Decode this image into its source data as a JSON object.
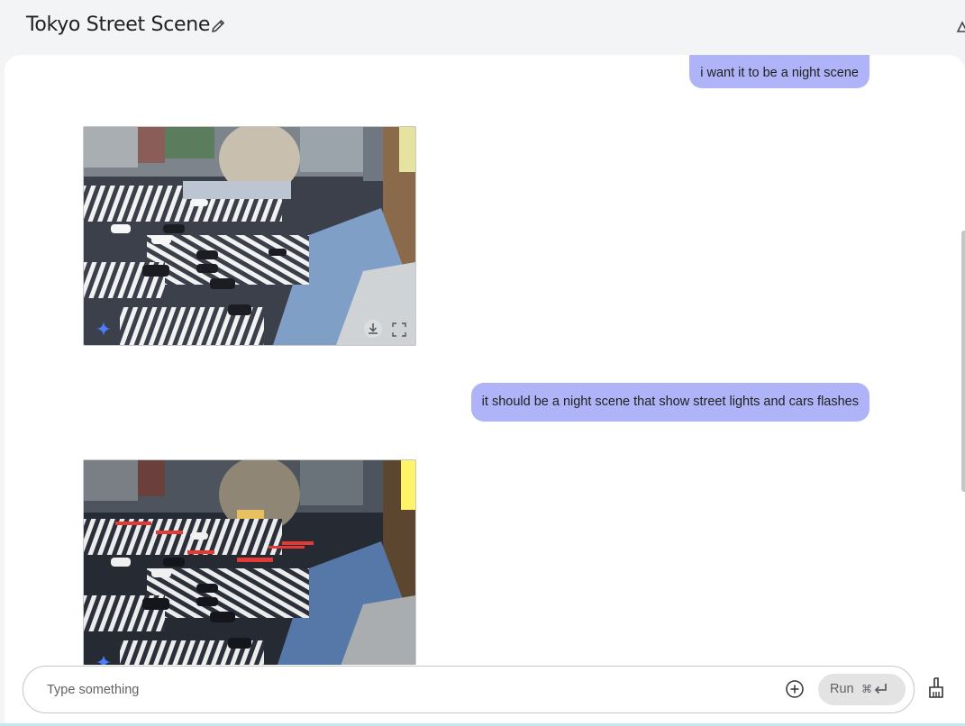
{
  "header": {
    "title": "Tokyo Street Scene"
  },
  "chat": {
    "messages": [
      {
        "role": "user",
        "text": "i want it to be a night scene"
      },
      {
        "role": "model",
        "type": "image",
        "description_icon": "sparkle-icon"
      },
      {
        "role": "user",
        "text": "it should be a night scene that show street lights and cars flashes"
      },
      {
        "role": "model",
        "type": "image",
        "description_icon": "sparkle-icon"
      }
    ]
  },
  "composer": {
    "placeholder": "Type something",
    "run_label": "Run",
    "shortcut_symbol": "⌘"
  },
  "colors": {
    "user_bubble": "#aeb4f7",
    "background": "#f3f4f6",
    "panel": "#ffffff"
  }
}
